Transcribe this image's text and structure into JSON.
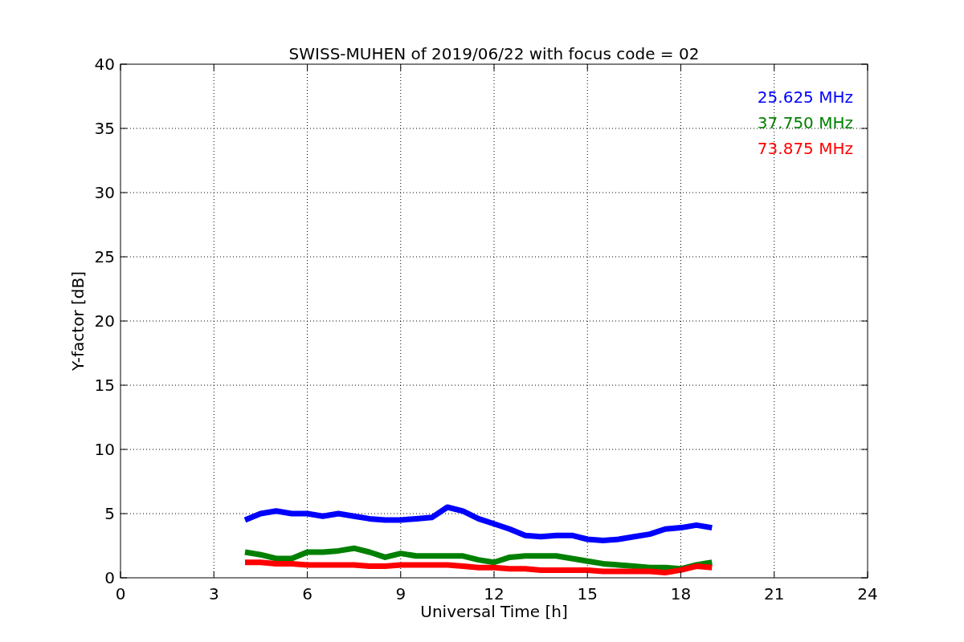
{
  "chart_data": {
    "type": "line",
    "title": "SWISS-MUHEN of 2019/06/22 with focus code = 02",
    "xlabel": "Universal Time [h]",
    "ylabel": "Y-factor [dB]",
    "x": [
      4,
      4.5,
      5,
      5.5,
      6,
      6.5,
      7,
      7.5,
      8,
      8.5,
      9,
      9.5,
      10,
      10.5,
      11,
      11.5,
      12,
      12.5,
      13,
      13.5,
      14,
      14.5,
      15,
      15.5,
      16,
      16.5,
      17,
      17.5,
      18,
      18.5,
      19
    ],
    "series": [
      {
        "name": "25.625 MHz",
        "color": "#0000ff",
        "values": [
          4.5,
          5,
          5.2,
          5,
          5,
          4.8,
          5,
          4.8,
          4.6,
          4.5,
          4.5,
          4.6,
          4.7,
          5.5,
          5.2,
          4.6,
          4.2,
          3.8,
          3.3,
          3.2,
          3.3,
          3.3,
          3.0,
          2.9,
          3.0,
          3.2,
          3.4,
          3.8,
          3.9,
          4.1,
          3.9
        ]
      },
      {
        "name": "37.750 MHz",
        "color": "#008000",
        "values": [
          2,
          1.8,
          1.5,
          1.5,
          2,
          2,
          2.1,
          2.3,
          2,
          1.6,
          1.9,
          1.7,
          1.7,
          1.7,
          1.7,
          1.4,
          1.2,
          1.6,
          1.7,
          1.7,
          1.7,
          1.5,
          1.3,
          1.1,
          1.0,
          0.9,
          0.8,
          0.8,
          0.7,
          1.0,
          1.2
        ]
      },
      {
        "name": "73.875 MHz",
        "color": "#ff0000",
        "values": [
          1.2,
          1.2,
          1.1,
          1.1,
          1,
          1,
          1,
          1,
          0.9,
          0.9,
          1,
          1,
          1,
          1,
          0.9,
          0.8,
          0.8,
          0.7,
          0.7,
          0.6,
          0.6,
          0.6,
          0.6,
          0.5,
          0.5,
          0.5,
          0.5,
          0.4,
          0.6,
          0.9,
          0.8
        ]
      }
    ],
    "grid": true,
    "xlim": [
      0,
      24
    ],
    "ylim": [
      0,
      40
    ],
    "xticks": [
      0,
      3,
      6,
      9,
      12,
      15,
      18,
      21,
      24
    ],
    "yticks": [
      0,
      5,
      10,
      15,
      20,
      25,
      30,
      35,
      40
    ]
  }
}
